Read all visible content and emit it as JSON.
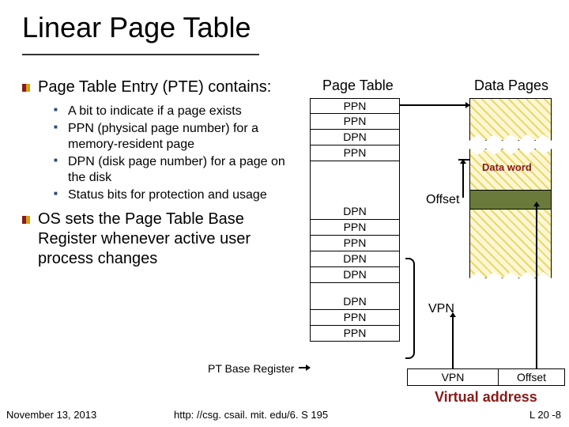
{
  "title": "Linear Page Table",
  "bullets": [
    {
      "text": "Page Table Entry (PTE) contains:",
      "subs": [
        "A bit to indicate if a page exists",
        "PPN (physical page number) for a memory-resident page",
        "DPN (disk page number) for a page on the disk",
        "Status bits for protection and usage"
      ]
    },
    {
      "text": "OS sets the Page Table Base Register whenever active user process changes",
      "subs": []
    }
  ],
  "diagram": {
    "pt_label": "Page Table",
    "dp_label": "Data Pages",
    "pt_entries_top": [
      "PPN",
      "PPN",
      "DPN",
      "PPN"
    ],
    "pt_entries_mid": [
      "DPN",
      "PPN",
      "PPN",
      "DPN",
      "DPN"
    ],
    "pt_entries_bot": [
      "DPN",
      "PPN",
      "PPN"
    ],
    "ptbr_label": "PT Base Register",
    "dword_label": "Data word",
    "offset_label": "Offset",
    "vpn_label": "VPN",
    "va_vpn": "VPN",
    "va_offset": "Offset",
    "va_label": "Virtual address"
  },
  "footer": {
    "date": "November 13, 2013",
    "url": "http: //csg. csail. mit. edu/6. S 195",
    "slide": "L 20 -8"
  }
}
